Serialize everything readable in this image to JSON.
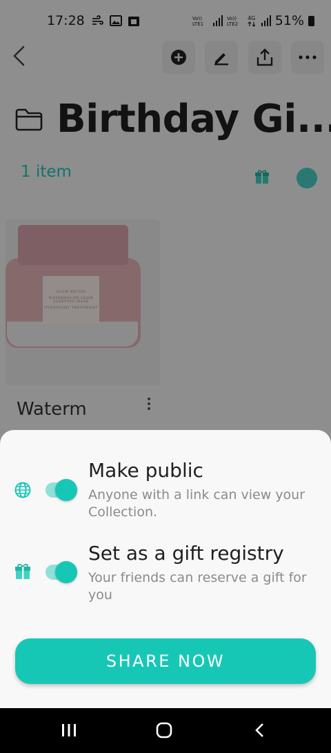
{
  "status_bar": {
    "time": "17:28",
    "network_label_1": "Vo))\nLTE1",
    "network_label_2": "Vo))\nLTE2",
    "network_gen": "4G",
    "battery": "51%"
  },
  "collection": {
    "title": "Birthday Gi...",
    "item_count": "1 item",
    "is_gift_registry": true,
    "is_public": true
  },
  "product": {
    "name": "Waterm",
    "image_brand": "GLOW RECIPE",
    "image_product": "WATERMELON GLOW SLEEPING MASK",
    "image_tagline": "OVERNIGHT TREATMENT"
  },
  "sheet": {
    "options": [
      {
        "title": "Make public",
        "description": "Anyone with a link can view your Collection.",
        "icon": "globe-icon",
        "enabled": true
      },
      {
        "title": "Set as a gift registry",
        "description": "Your friends can reserve a gift for you",
        "icon": "gift-icon",
        "enabled": true
      }
    ],
    "share_label": "SHARE NOW"
  },
  "colors": {
    "accent": "#17c7b6",
    "accent_light": "#8fe0d8",
    "text_dark": "#1f1f1f",
    "text_muted": "#8a8a8a"
  },
  "icons": {
    "back": "chevron-left-icon",
    "add": "add-circle-icon",
    "edit": "pencil-icon",
    "share": "share-icon",
    "more": "more-horizontal-icon",
    "folder": "folder-icon"
  }
}
